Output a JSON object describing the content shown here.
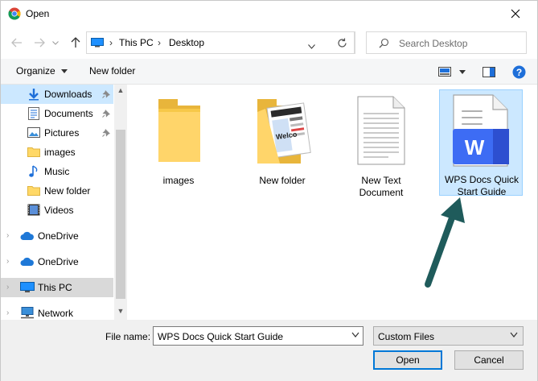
{
  "window": {
    "title": "Open"
  },
  "address": {
    "crumbs": [
      "This PC",
      "Desktop"
    ]
  },
  "search": {
    "placeholder": "Search Desktop"
  },
  "toolbar": {
    "organize": "Organize",
    "new_folder": "New folder"
  },
  "sidebar": {
    "items": [
      {
        "label": "Downloads",
        "icon": "download-icon",
        "pinned": true
      },
      {
        "label": "Documents",
        "icon": "documents-icon",
        "pinned": true
      },
      {
        "label": "Pictures",
        "icon": "pictures-icon",
        "pinned": true
      },
      {
        "label": "images",
        "icon": "folder-icon"
      },
      {
        "label": "Music",
        "icon": "music-icon"
      },
      {
        "label": "New folder",
        "icon": "folder-icon"
      },
      {
        "label": "Videos",
        "icon": "videos-icon"
      },
      {
        "label": "OneDrive",
        "icon": "cloud-icon"
      },
      {
        "label": "OneDrive",
        "icon": "cloud-icon"
      },
      {
        "label": "This PC",
        "icon": "computer-icon"
      },
      {
        "label": "Network",
        "icon": "network-icon"
      }
    ]
  },
  "files": [
    {
      "name": "images",
      "type": "folder"
    },
    {
      "name": "New folder",
      "type": "folder-with-content"
    },
    {
      "name": "New Text Document",
      "type": "text-document"
    },
    {
      "name": "WPS Docs Quick Start Guide",
      "type": "wps-document",
      "selected": true
    }
  ],
  "bottom": {
    "file_name_label": "File name:",
    "file_name_value": "WPS Docs Quick Start Guide",
    "file_type_value": "Custom Files",
    "open_label": "Open",
    "cancel_label": "Cancel"
  },
  "colors": {
    "accent": "#0078d7",
    "selection": "#cce8ff",
    "wps_blue": "#3d6cf4",
    "annotation_arrow": "#1f5b5b"
  }
}
